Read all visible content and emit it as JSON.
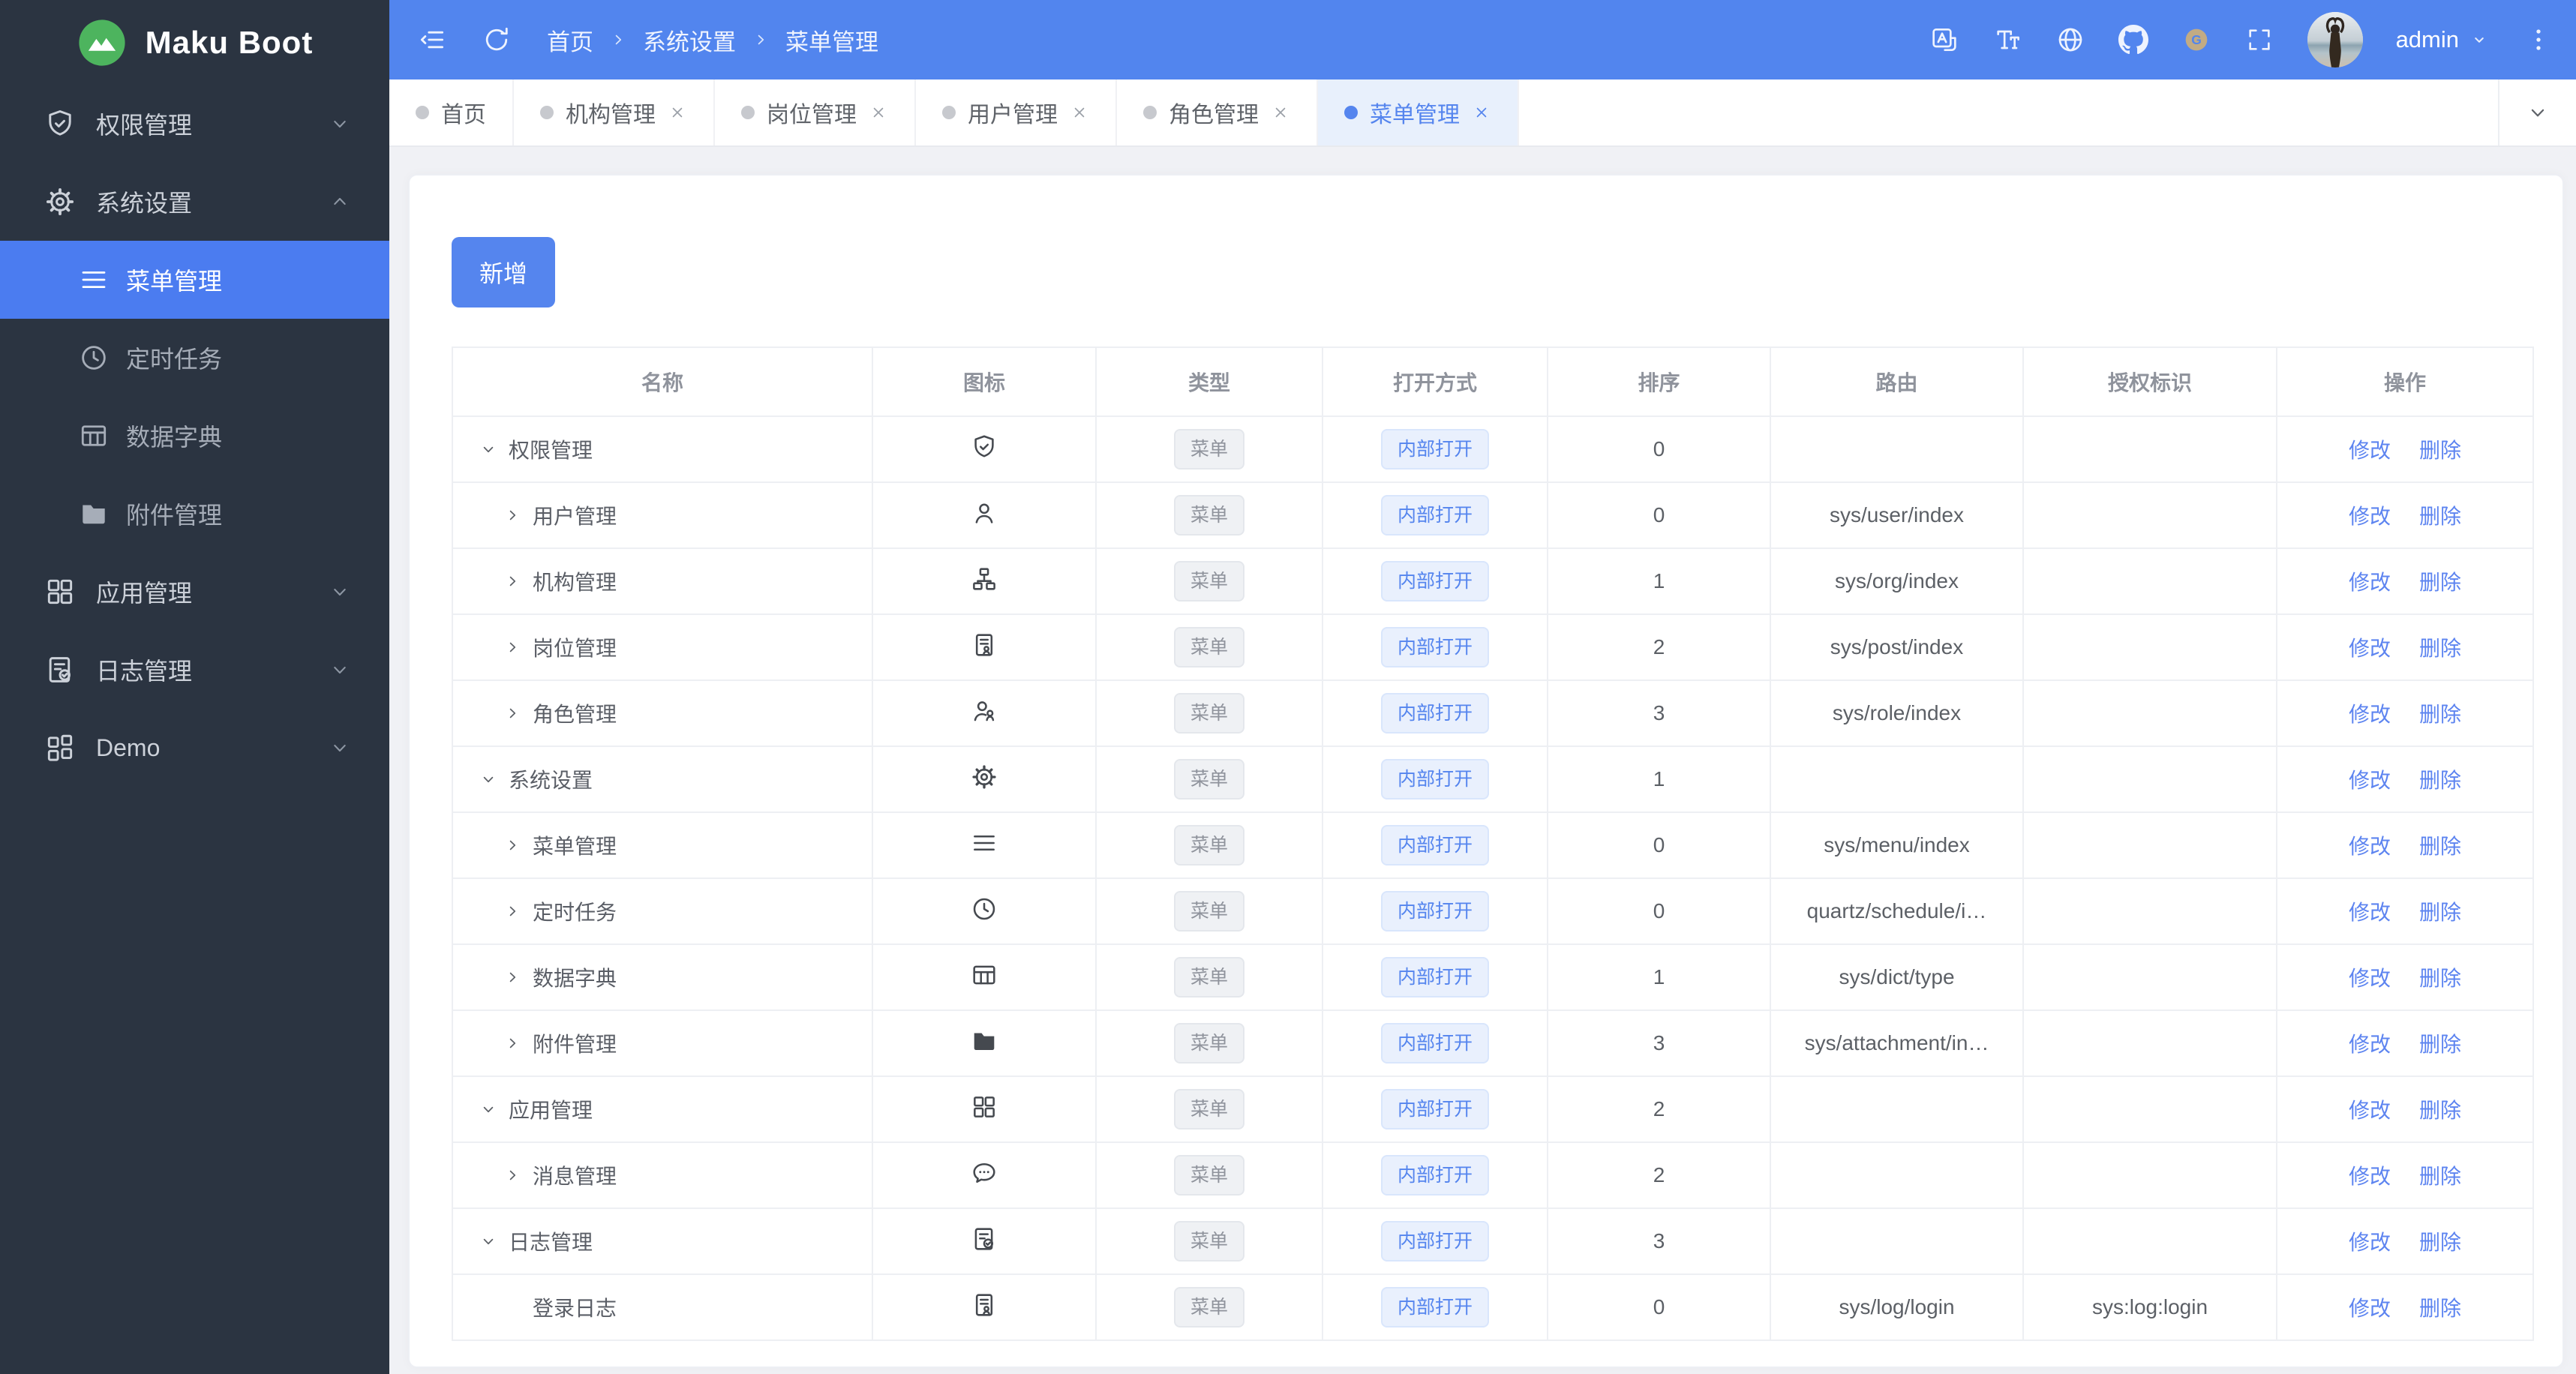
{
  "app": {
    "name": "Maku Boot",
    "logo_icon": "mountain-logo-icon"
  },
  "colors": {
    "header_bg": "#5285ee",
    "sidebar_bg": "#2b3441",
    "sidebar_active_bg": "#4b7cf0",
    "primary": "#5585ee",
    "tab_active_bg": "#e8f0fc",
    "content_bg": "#f0f1f5",
    "table_border": "#edeff3",
    "link": "#5d84f0",
    "logo_green": "#4db45e",
    "gitee_gold": "#c2ab84"
  },
  "sidebar": {
    "items": [
      {
        "id": "permission",
        "label": "权限管理",
        "icon": "shield-check-icon",
        "chevron": "down"
      },
      {
        "id": "system",
        "label": "系统设置",
        "icon": "gear-icon",
        "chevron": "up",
        "expanded": true,
        "children": [
          {
            "id": "menu",
            "label": "菜单管理",
            "icon": "menu-icon",
            "active": true
          },
          {
            "id": "schedule",
            "label": "定时任务",
            "icon": "clock-icon"
          },
          {
            "id": "dict",
            "label": "数据字典",
            "icon": "table-icon"
          },
          {
            "id": "attachment",
            "label": "附件管理",
            "icon": "folder-icon"
          }
        ]
      },
      {
        "id": "app",
        "label": "应用管理",
        "icon": "grid-icon",
        "chevron": "down"
      },
      {
        "id": "log",
        "label": "日志管理",
        "icon": "document-check-icon",
        "chevron": "down"
      },
      {
        "id": "demo",
        "label": "Demo",
        "icon": "apps-icon",
        "chevron": "down"
      }
    ]
  },
  "topbar": {
    "left_icons": [
      {
        "name": "menu-fold-icon"
      },
      {
        "name": "refresh-icon"
      }
    ],
    "breadcrumb": [
      "首页",
      "系统设置",
      "菜单管理"
    ],
    "right_icons": [
      {
        "name": "translate-icon"
      },
      {
        "name": "font-size-icon"
      },
      {
        "name": "globe-icon"
      },
      {
        "name": "github-icon"
      },
      {
        "name": "gitee-icon"
      },
      {
        "name": "fullscreen-icon"
      }
    ],
    "user": {
      "name": "admin"
    }
  },
  "tabs": {
    "items": [
      {
        "id": "home",
        "label": "首页",
        "closable": false,
        "active": false
      },
      {
        "id": "org",
        "label": "机构管理",
        "closable": true,
        "active": false
      },
      {
        "id": "post",
        "label": "岗位管理",
        "closable": true,
        "active": false
      },
      {
        "id": "user",
        "label": "用户管理",
        "closable": true,
        "active": false
      },
      {
        "id": "role",
        "label": "角色管理",
        "closable": true,
        "active": false
      },
      {
        "id": "menu",
        "label": "菜单管理",
        "closable": true,
        "active": true
      }
    ]
  },
  "toolbar": {
    "add_label": "新增"
  },
  "table": {
    "columns": [
      "名称",
      "图标",
      "类型",
      "打开方式",
      "排序",
      "路由",
      "授权标识",
      "操作"
    ],
    "type_tag": "菜单",
    "open_tag": "内部打开",
    "actions": [
      "修改",
      "删除"
    ],
    "rows": [
      {
        "name": "权限管理",
        "level": 0,
        "expand": "down",
        "icon": "shield-check-icon",
        "sort": "0",
        "route": "",
        "perm": ""
      },
      {
        "name": "用户管理",
        "level": 1,
        "expand": "right",
        "icon": "user-icon",
        "sort": "0",
        "route": "sys/user/index",
        "perm": ""
      },
      {
        "name": "机构管理",
        "level": 1,
        "expand": "right",
        "icon": "org-icon",
        "sort": "1",
        "route": "sys/org/index",
        "perm": ""
      },
      {
        "name": "岗位管理",
        "level": 1,
        "expand": "right",
        "icon": "badge-icon",
        "sort": "2",
        "route": "sys/post/index",
        "perm": ""
      },
      {
        "name": "角色管理",
        "level": 1,
        "expand": "right",
        "icon": "role-icon",
        "sort": "3",
        "route": "sys/role/index",
        "perm": ""
      },
      {
        "name": "系统设置",
        "level": 0,
        "expand": "down",
        "icon": "gear-icon",
        "sort": "1",
        "route": "",
        "perm": ""
      },
      {
        "name": "菜单管理",
        "level": 1,
        "expand": "right",
        "icon": "menu-icon",
        "sort": "0",
        "route": "sys/menu/index",
        "perm": ""
      },
      {
        "name": "定时任务",
        "level": 1,
        "expand": "right",
        "icon": "clock-icon",
        "sort": "0",
        "route": "quartz/schedule/i…",
        "perm": ""
      },
      {
        "name": "数据字典",
        "level": 1,
        "expand": "right",
        "icon": "table-icon",
        "sort": "1",
        "route": "sys/dict/type",
        "perm": ""
      },
      {
        "name": "附件管理",
        "level": 1,
        "expand": "right",
        "icon": "folder-icon",
        "sort": "3",
        "route": "sys/attachment/in…",
        "perm": ""
      },
      {
        "name": "应用管理",
        "level": 0,
        "expand": "down",
        "icon": "grid-icon",
        "sort": "2",
        "route": "",
        "perm": ""
      },
      {
        "name": "消息管理",
        "level": 1,
        "expand": "right",
        "icon": "chat-icon",
        "sort": "2",
        "route": "",
        "perm": ""
      },
      {
        "name": "日志管理",
        "level": 0,
        "expand": "down",
        "icon": "document-check-icon",
        "sort": "3",
        "route": "",
        "perm": ""
      },
      {
        "name": "登录日志",
        "level": 1,
        "expand": "none",
        "icon": "badge-icon",
        "sort": "0",
        "route": "sys/log/login",
        "perm": "sys:log:login"
      }
    ]
  }
}
